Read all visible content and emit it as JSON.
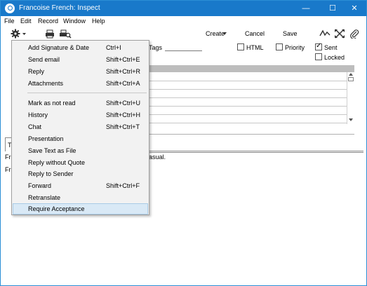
{
  "window": {
    "title": "Francoise French: Inspect"
  },
  "window_controls": {
    "minimize": "—",
    "maximize": "☐",
    "close": "✕"
  },
  "menubar": {
    "items": [
      "File",
      "Edit",
      "Record",
      "Window",
      "Help"
    ]
  },
  "toolbar": {
    "create": "Create",
    "cancel": "Cancel",
    "save": "Save"
  },
  "form": {
    "tags_label": "Tags",
    "html_label": "HTML",
    "priority_label": "Priority",
    "sent_label": "Sent",
    "sent_checked": true,
    "locked_label": "Locked",
    "locked_checked": false,
    "tab_fragment": "T",
    "body_fragment_1": "Fr",
    "body_fragment_1_end": "asual.",
    "body_fragment_2": "Fr"
  },
  "dropdown": {
    "items": [
      {
        "label": "Add Signature & Date",
        "shortcut": "Ctrl+I"
      },
      {
        "label": "Send email",
        "shortcut": "Shift+Ctrl+E"
      },
      {
        "label": "Reply",
        "shortcut": "Shift+Ctrl+R"
      },
      {
        "label": "Attachments",
        "shortcut": "Shift+Ctrl+A"
      },
      {
        "label": "Mark as not read",
        "shortcut": "Shift+Ctrl+U"
      },
      {
        "label": "History",
        "shortcut": "Shift+Ctrl+H"
      },
      {
        "label": "Chat",
        "shortcut": "Shift+Ctrl+T"
      },
      {
        "label": "Presentation",
        "shortcut": ""
      },
      {
        "label": "Save Text as File",
        "shortcut": ""
      },
      {
        "label": "Reply without Quote",
        "shortcut": ""
      },
      {
        "label": "Reply to Sender",
        "shortcut": ""
      },
      {
        "label": "Forward",
        "shortcut": "Shift+Ctrl+F"
      },
      {
        "label": "Retranslate",
        "shortcut": ""
      },
      {
        "label": "Require Acceptance",
        "shortcut": ""
      }
    ]
  },
  "colors": {
    "titlebar": "#1979ca",
    "highlight": "#d9e9f6",
    "menu_bg": "#f2f2f2"
  },
  "icons": [
    "app-icon",
    "gear-icon",
    "print-icon",
    "print-preview-icon",
    "wave-icon",
    "expand-icon",
    "paperclip-icon"
  ]
}
